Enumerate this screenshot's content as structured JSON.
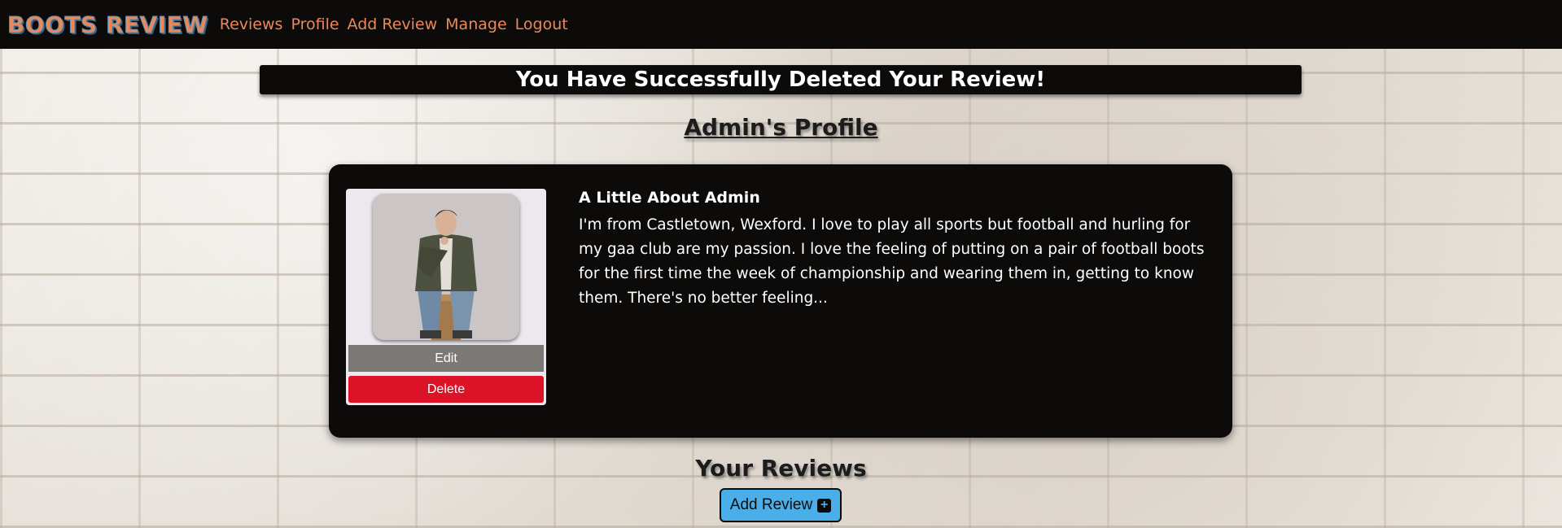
{
  "navbar": {
    "brand": "BOOTS REVIEW",
    "links": [
      "Reviews",
      "Profile",
      "Add Review",
      "Manage",
      "Logout"
    ]
  },
  "flash": {
    "message": "You Have Successfully Deleted Your Review!"
  },
  "profile": {
    "title": "Admin's Profile",
    "about_heading": "A Little About Admin",
    "about_text": "I'm from Castletown, Wexford. I love to play all sports but football and hurling for my gaa club are my passion. I love the feeling of putting on a pair of football boots for the first time the week of championship and wearing them in, getting to know them. There's no better feeling...",
    "edit_label": "Edit",
    "delete_label": "Delete",
    "avatar_icon": "user-photo"
  },
  "reviews": {
    "title": "Your Reviews",
    "add_label": "Add Review",
    "add_icon": "plus-square-icon"
  },
  "colors": {
    "accent": "#e9895b",
    "dark": "#0c0b0a",
    "delete": "#dc1226",
    "edit": "#7c7876",
    "add_button": "#4aaee8"
  }
}
